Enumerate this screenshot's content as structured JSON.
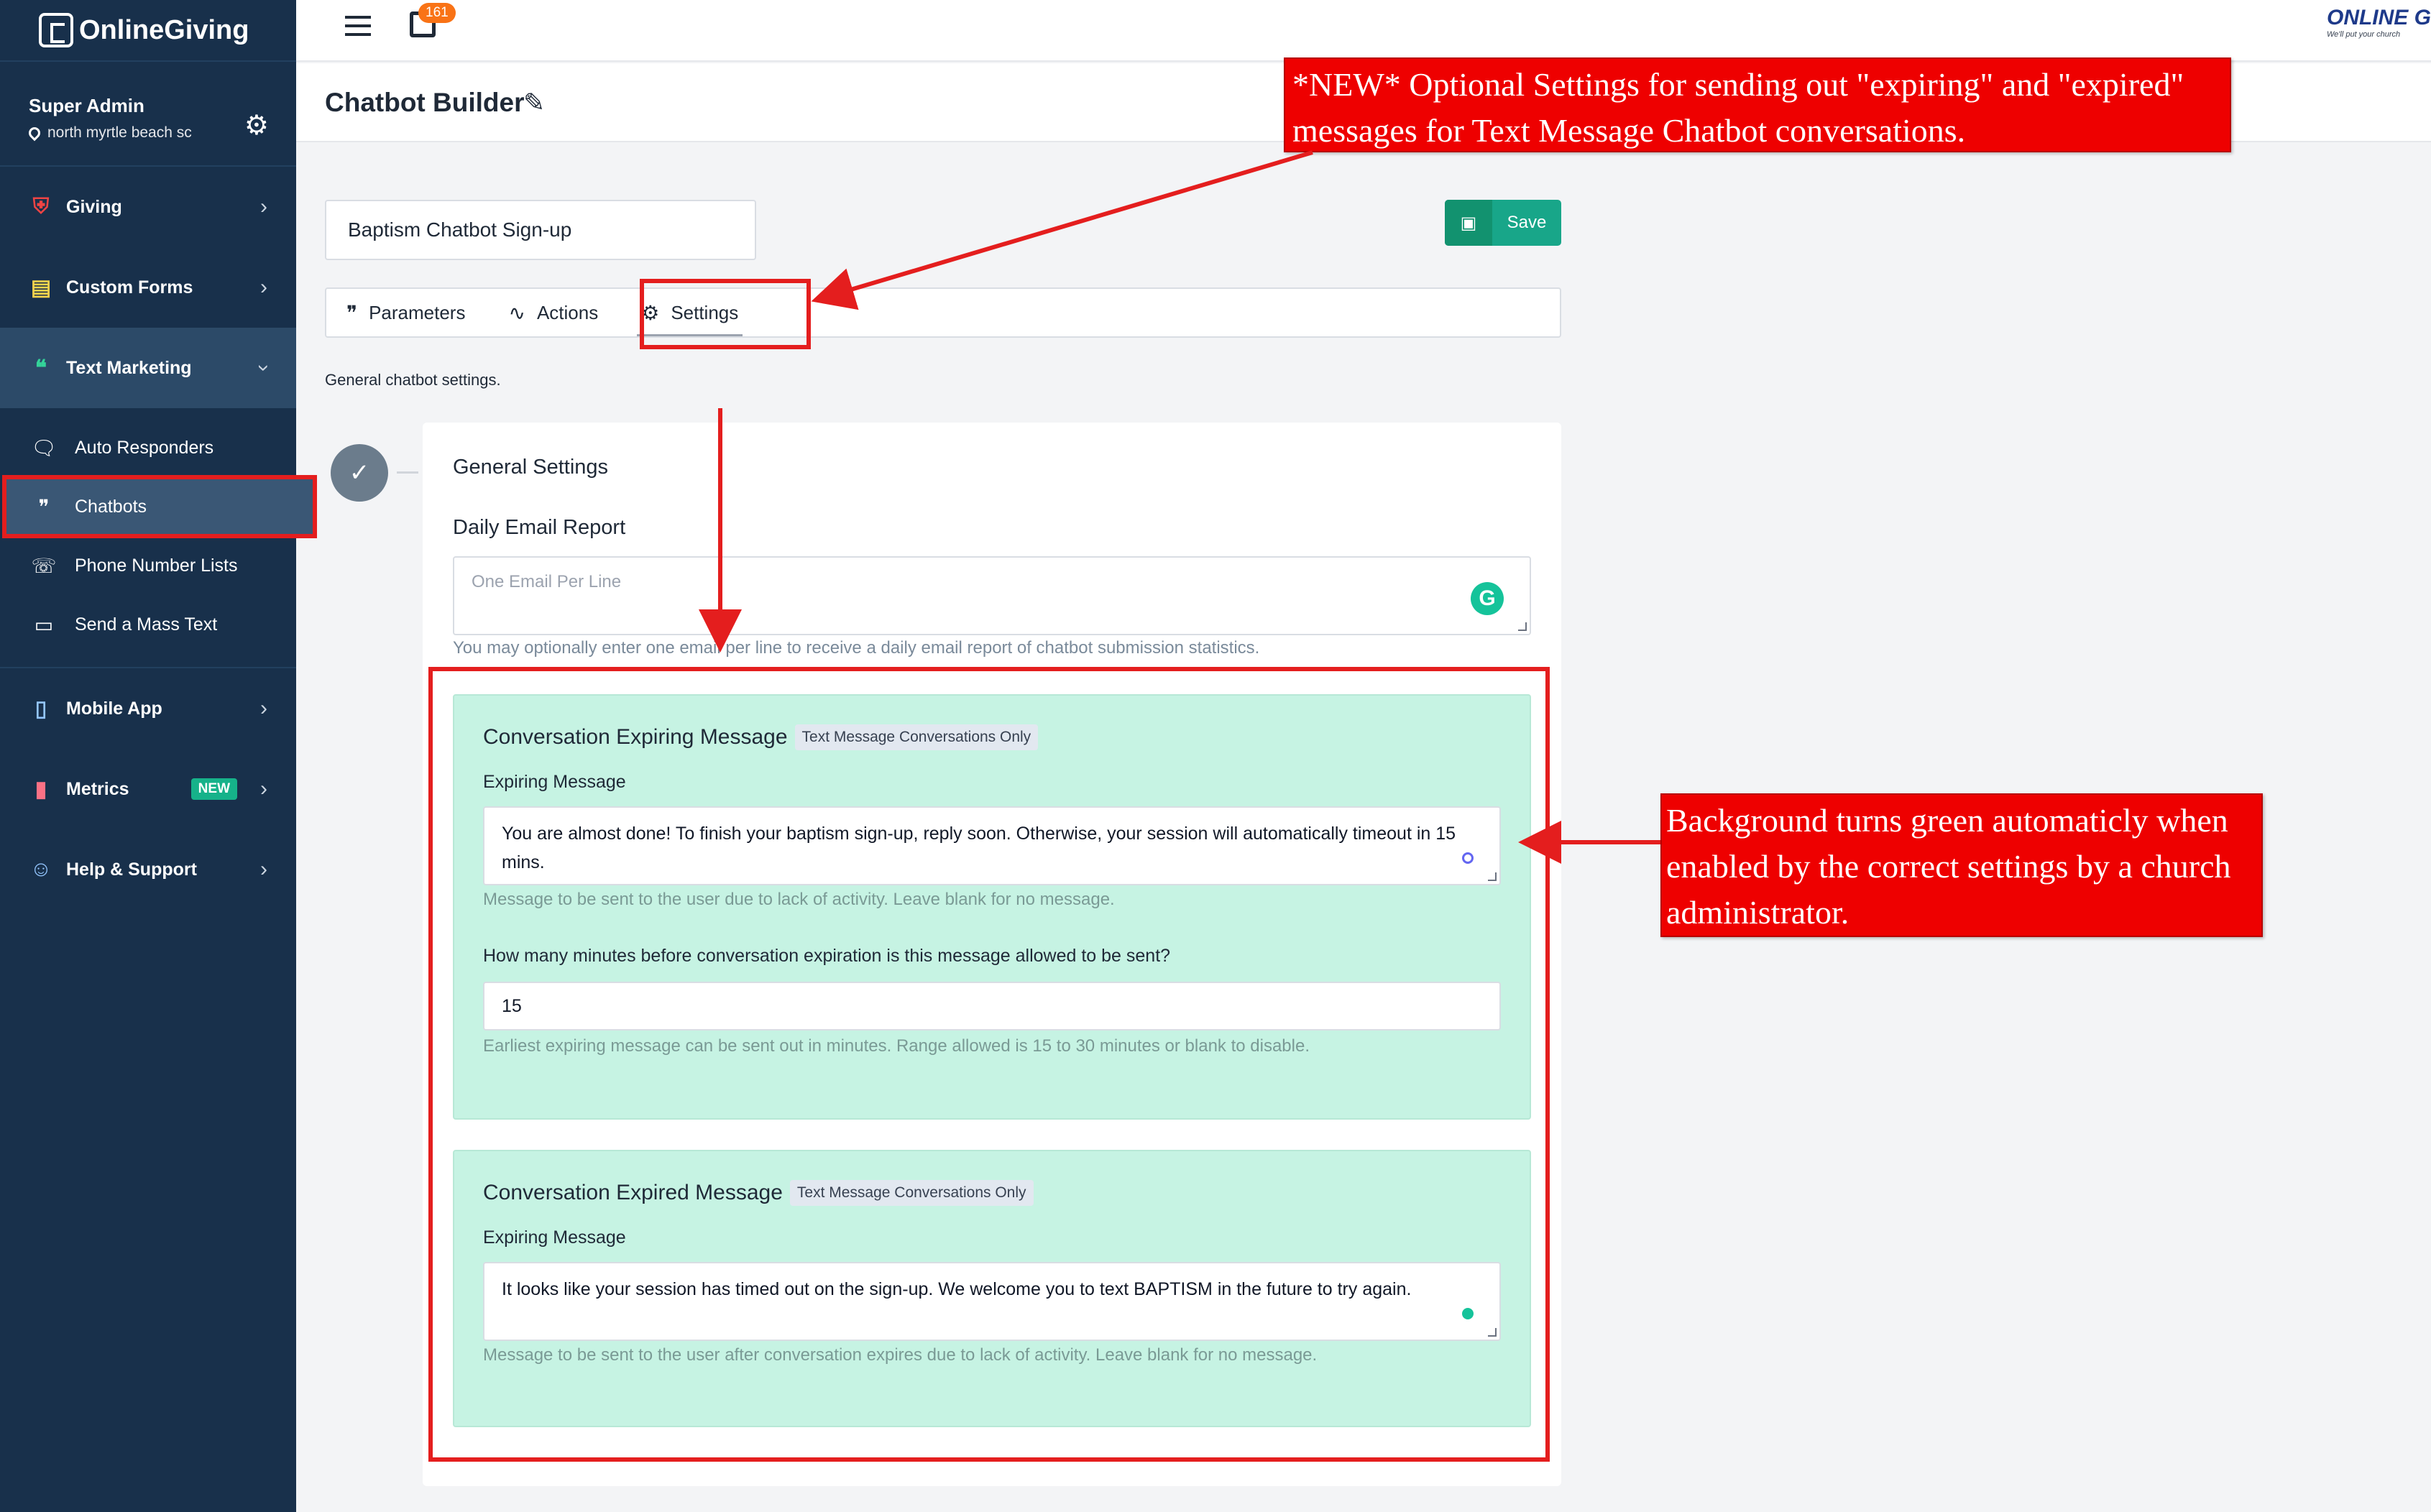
{
  "sidebar": {
    "brand": "OnlineGiving",
    "user_name": "Super Admin",
    "user_location": "north myrtle beach sc",
    "items": [
      {
        "label": "Giving"
      },
      {
        "label": "Custom Forms"
      },
      {
        "label": "Text Marketing"
      },
      {
        "label": "Mobile App"
      },
      {
        "label": "Metrics",
        "badge": "NEW"
      },
      {
        "label": "Help & Support"
      }
    ],
    "sub_items": [
      {
        "label": "Auto Responders"
      },
      {
        "label": "Chatbots"
      },
      {
        "label": "Phone Number Lists"
      },
      {
        "label": "Send a Mass Text"
      }
    ]
  },
  "topbar": {
    "notification_count": "161",
    "brand_right": "ONLINE G",
    "brand_tagline": "We'll put your church"
  },
  "header": {
    "title": "Chatbot Builder"
  },
  "main": {
    "chatbot_name": "Baptism Chatbot Sign-up",
    "save_label": "Save",
    "tabs": [
      {
        "label": "Parameters"
      },
      {
        "label": "Actions"
      },
      {
        "label": "Settings"
      }
    ],
    "general_text": "General chatbot settings.",
    "general_settings_title": "General Settings",
    "daily_email_label": "Daily Email Report",
    "daily_email_placeholder": "One Email Per Line",
    "daily_email_help": "You may optionally enter one email per line to receive a daily email report of chatbot submission statistics.",
    "expiring": {
      "title": "Conversation Expiring Message",
      "badge": "Text Message Conversations Only",
      "message_label": "Expiring Message",
      "message_value": "You are almost done! To finish your baptism sign-up, reply soon. Otherwise, your session will automatically timeout in 15 mins.",
      "message_help": "Message to be sent to the user due to lack of activity. Leave blank for no message.",
      "minutes_label": "How many minutes before conversation expiration is this message allowed to be sent?",
      "minutes_value": "15",
      "minutes_help": "Earliest expiring message can be sent out in minutes. Range allowed is 15 to 30 minutes or blank to disable."
    },
    "expired": {
      "title": "Conversation Expired Message",
      "badge": "Text Message Conversations Only",
      "message_label": "Expiring Message",
      "message_value": "It looks like your session has timed out on the sign-up. We welcome you to text BAPTISM in the future to try again.",
      "message_help": "Message to be sent to the user after conversation expires due to lack of activity. Leave blank for no message."
    }
  },
  "annotations": {
    "top_callout": "*NEW* Optional Settings for sending out \"expiring\" and \"expired\" messages for Text Message Chatbot conversations.",
    "right_callout": "Background turns green automaticly when enabled by the correct settings by a church administrator."
  },
  "colors": {
    "sidebar_bg": "#18304b",
    "accent_green": "#18a689",
    "panel_green": "#c6f3e3",
    "annotation_red": "#e41e1e"
  }
}
